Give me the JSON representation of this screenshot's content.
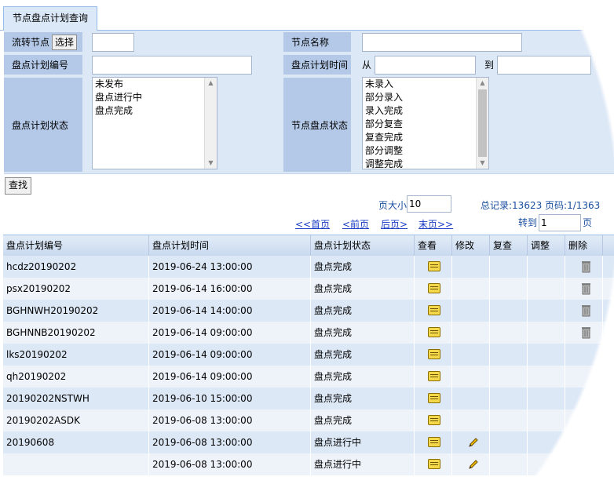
{
  "tab": {
    "title": "节点盘点计划查询"
  },
  "form": {
    "flow_node_label": "流转节点",
    "select_button": "选择",
    "node_name_label": "节点名称",
    "plan_no_label": "盘点计划编号",
    "plan_time_label": "盘点计划时间",
    "from_label": "从",
    "to_label": "到",
    "plan_status_label": "盘点计划状态",
    "plan_status_options": [
      "未发布",
      "盘点进行中",
      "盘点完成"
    ],
    "node_status_label": "节点盘点状态",
    "node_status_options": [
      "未录入",
      "部分录入",
      "录入完成",
      "部分复查",
      "复查完成",
      "部分调整",
      "调整完成"
    ]
  },
  "search_button": "查找",
  "pager": {
    "page_size_label": "页大小",
    "page_size_value": "10",
    "total_text": "总记录:13623 页码:1/1363",
    "first": "<<首页",
    "prev": "<前页",
    "next": "后页>",
    "last": "末页>>",
    "goto_label": "转到",
    "goto_value": "1",
    "page_suffix": "页"
  },
  "table": {
    "columns": [
      "盘点计划编号",
      "盘点计划时间",
      "盘点计划状态",
      "查看",
      "修改",
      "复查",
      "调整",
      "删除",
      ""
    ],
    "rows": [
      {
        "no": "hcdz20190202",
        "time": "2019-06-24 13:00:00",
        "status": "盘点完成",
        "edit": false,
        "delete": true
      },
      {
        "no": "psx20190202",
        "time": "2019-06-14 16:00:00",
        "status": "盘点完成",
        "edit": false,
        "delete": true
      },
      {
        "no": "BGHNWH20190202",
        "time": "2019-06-14 14:00:00",
        "status": "盘点完成",
        "edit": false,
        "delete": true
      },
      {
        "no": "BGHNNB20190202",
        "time": "2019-06-14 09:00:00",
        "status": "盘点完成",
        "edit": false,
        "delete": true
      },
      {
        "no": "lks20190202",
        "time": "2019-06-14 09:00:00",
        "status": "盘点完成",
        "edit": false,
        "delete": false
      },
      {
        "no": "qh20190202",
        "time": "2019-06-14 09:00:00",
        "status": "盘点完成",
        "edit": false,
        "delete": false
      },
      {
        "no": "20190202NSTWH",
        "time": "2019-06-10 15:00:00",
        "status": "盘点完成",
        "edit": false,
        "delete": false
      },
      {
        "no": "20190202ASDK",
        "time": "2019-06-08 13:00:00",
        "status": "盘点完成",
        "edit": false,
        "delete": false
      },
      {
        "no": "20190608",
        "time": "2019-06-08 13:00:00",
        "status": "盘点进行中",
        "edit": true,
        "delete": false
      },
      {
        "no": "",
        "time": "2019-06-08 13:00:00",
        "status": "盘点进行中",
        "edit": true,
        "delete": false
      }
    ]
  },
  "icons": {
    "view": "view-icon",
    "edit": "pencil-icon",
    "delete": "trash-icon"
  },
  "colors": {
    "label_bg": "#b4c9e8",
    "row_bg": "#dde8f6",
    "link": "#1a3cc4",
    "info": "#1a4fa0"
  }
}
